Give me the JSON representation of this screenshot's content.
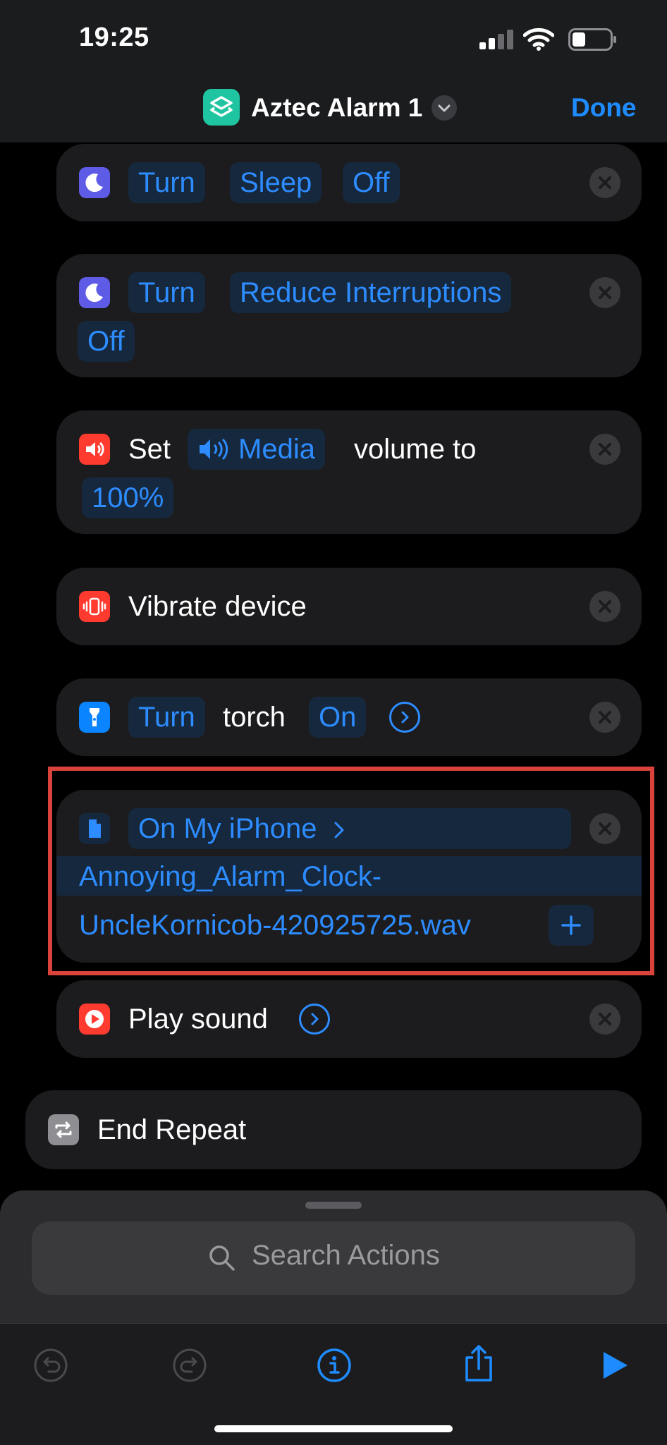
{
  "status_bar": {
    "time": "19:25"
  },
  "nav": {
    "title": "Aztec Alarm 1",
    "done_label": "Done"
  },
  "actions": [
    {
      "verb": "Turn",
      "target": "Sleep",
      "state": "Off"
    },
    {
      "verb": "Turn",
      "target": "Reduce Interruptions",
      "state": "Off"
    },
    {
      "verb": "Set",
      "source": "Media",
      "middle": "volume to",
      "value": "100%"
    },
    {
      "label": "Vibrate device"
    },
    {
      "verb": "Turn",
      "object": "torch",
      "state": "On"
    },
    {
      "location": "On My iPhone",
      "file_line1": "Annoying_Alarm_Clock-",
      "file_line2": "UncleKornicob-420925725.wav"
    },
    {
      "label": "Play sound"
    }
  ],
  "end_repeat": {
    "label": "End Repeat"
  },
  "bottom_sheet": {
    "search_placeholder": "Search Actions"
  },
  "colors": {
    "accent": "#1e8cff",
    "highlight": "#d9433b",
    "focus": "#5e5ce6",
    "red": "#ff3b30",
    "blue": "#0a84ff"
  }
}
